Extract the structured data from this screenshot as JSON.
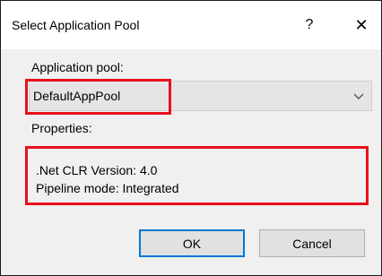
{
  "dialog": {
    "title": "Select Application Pool",
    "help_label": "?",
    "close_label": "✕"
  },
  "form": {
    "pool_label": "Application pool:",
    "pool_value": "DefaultAppPool",
    "properties_label": "Properties:",
    "properties": [
      ".Net CLR Version: 4.0",
      "Pipeline mode: Integrated"
    ]
  },
  "buttons": {
    "ok_label": "OK",
    "cancel_label": "Cancel"
  },
  "colors": {
    "highlight": "#e8101c",
    "default_button_border": "#0078d7"
  },
  "icons": {
    "dropdown": "chevron-down-icon"
  }
}
